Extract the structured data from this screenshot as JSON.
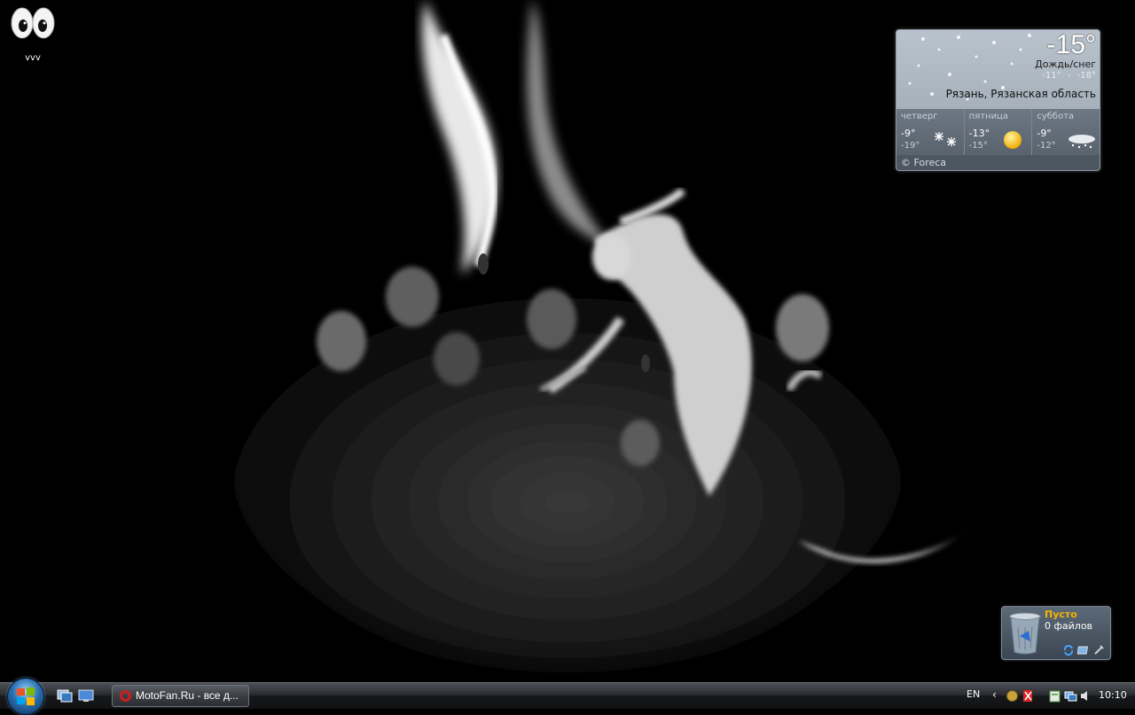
{
  "desktop": {
    "icons": [
      {
        "label": "vvv",
        "icon": "googly-eyes-icon"
      }
    ]
  },
  "weather_gadget": {
    "temperature": "-15°",
    "condition": "Дождь/снег",
    "range_high": "-11°",
    "range_sep": "-",
    "range_low": "-18°",
    "location": "Рязань, Рязанская область",
    "forecast": [
      {
        "day": "четверг",
        "high": "-9°",
        "low": "-19°",
        "icon": "snow-icon"
      },
      {
        "day": "пятница",
        "high": "-13°",
        "low": "-15°",
        "icon": "sun-icon"
      },
      {
        "day": "суббота",
        "high": "-9°",
        "low": "-12°",
        "icon": "snow-cloud-icon"
      }
    ],
    "provider": "© Foreca"
  },
  "recycle_gadget": {
    "status": "Пусто",
    "count": "0 файлов"
  },
  "taskbar": {
    "tasks": [
      {
        "label": "MotoFan.Ru - все д...",
        "icon": "opera-icon"
      }
    ],
    "language": "EN",
    "clock": "10:10"
  },
  "colors": {
    "taskbar": "#1a1b1e",
    "recycle_title": "#f4b400",
    "opera_red": "#d21b1b"
  }
}
